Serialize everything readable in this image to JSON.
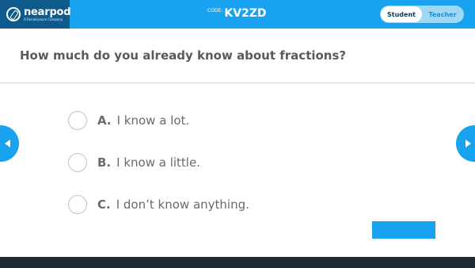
{
  "brand": {
    "name": "nearpod",
    "tagline": "A Renaissance Company",
    "logo_icon": "nearpod-logo-icon"
  },
  "session": {
    "code_label": "CODE:",
    "code_value": "KV2ZD"
  },
  "role_toggle": {
    "student_label": "Student",
    "teacher_label": "Teacher",
    "selected": "Student"
  },
  "question": {
    "text": "How much do you already know about fractions?"
  },
  "options": [
    {
      "letter": "A.",
      "text": "I know a lot."
    },
    {
      "letter": "B.",
      "text": "I know a little."
    },
    {
      "letter": "C.",
      "text": "I don’t know anything."
    }
  ],
  "navigation": {
    "prev_icon": "chevron-left-icon",
    "next_icon": "chevron-right-icon"
  },
  "colors": {
    "primary": "#18A2F0",
    "logo_bg": "#0E5A8A",
    "footer": "#1F2A33",
    "question_text": "#5a5a5a"
  }
}
